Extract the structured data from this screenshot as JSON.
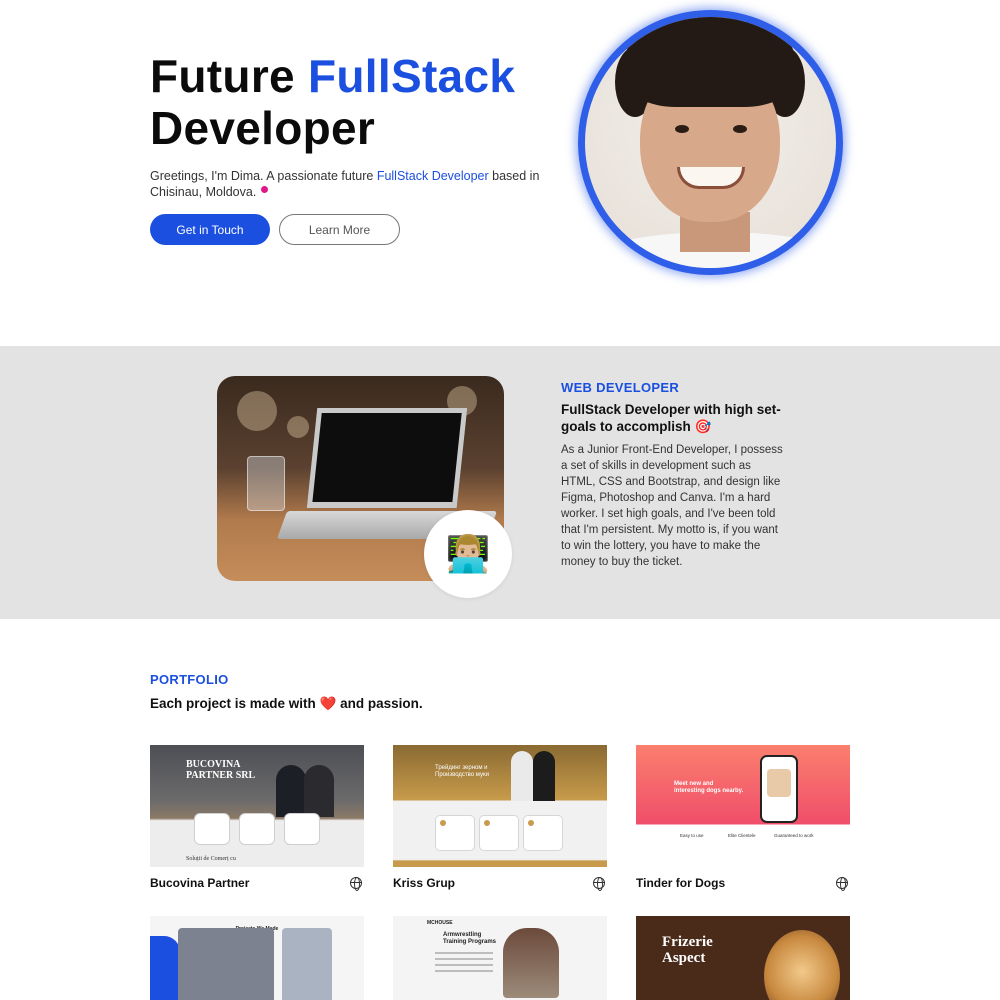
{
  "hero": {
    "title_line1_plain": "Future",
    "title_line1_accent": "FullStack",
    "title_line2": "Developer",
    "intro_before": "Greetings, I'm Dima. A passionate future",
    "intro_accent": "FullStack Developer",
    "intro_after": "based in Chisinau, Moldova.",
    "primary_button": "Get in Touch",
    "secondary_button": "Learn More",
    "accent_color": "#1a4fe0"
  },
  "about": {
    "tag": "WEB DEVELOPER",
    "heading": "FullStack Developer with high set-goals to accomplish 🎯",
    "text": "As a Junior Front-End Developer, I possess a set of skills in development such as HTML, CSS and Bootstrap, and design like Figma, Photoshop and Canva. I'm a hard worker. I set high goals, and I've been told that I'm persistent. My motto is, if you want to win the lottery, you have to make the money to buy the ticket.",
    "emoji": "👨🏼‍💻"
  },
  "portfolio": {
    "tag": "PORTFOLIO",
    "heading_before": "Each project is made with",
    "heading_emoji": "❤️",
    "heading_after": "and passion.",
    "projects": [
      {
        "title": "Bucovina Partner",
        "thumb_brand": "BUCOVINA PARTNER SRL",
        "thumb_caption": "Soluții de Comerț cu",
        "icon": "globe-icon"
      },
      {
        "title": "Kriss Grup",
        "thumb_text": "Трейдинг зерном и Производство муки",
        "icon": "globe-icon"
      },
      {
        "title": "Tinder for Dogs",
        "thumb_text": "Meet new and interesting dogs nearby.",
        "thumb_features": [
          "Easy to use",
          "Elite Clientele",
          "Guaranteed to work"
        ],
        "icon": "globe-icon"
      },
      {
        "title": "",
        "thumb_heading": "Projects We Made"
      },
      {
        "title": "",
        "thumb_logo": "MCHOUSE",
        "thumb_heading": "Armwrestling Training Programs"
      },
      {
        "title": "",
        "thumb_heading": "Frizerie Aspect"
      }
    ]
  }
}
